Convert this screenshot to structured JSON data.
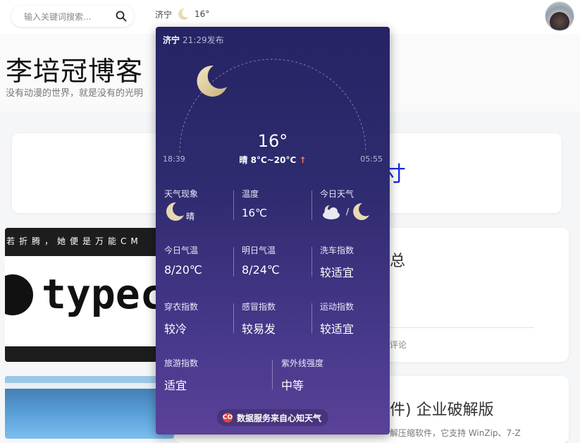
{
  "header": {
    "search_placeholder": "输入关键词搜索...",
    "city": "济宁",
    "temp": "16°"
  },
  "site": {
    "title": "李培冠博客",
    "subtitle": "没有动漫的世界，就是没有的光明"
  },
  "background": {
    "thumb1_band": "若折腾，她便是万能CM",
    "thumb1_word": "typec",
    "post1_title_fragment": "总",
    "post1_meta_fragment": "评论",
    "post2_title_fragment": "件) 企业破解版",
    "post2_excerpt_fragment": "解压缩软件，它支持 WinZip、7-Z",
    "card_title_fragment": "寸"
  },
  "weather_popup": {
    "city": "济宁",
    "published": "21:29发布",
    "current_temp": "16°",
    "condition_range": "晴 8°C~20°C",
    "sunrise": "18:39",
    "sunset": "05:55",
    "rows": [
      [
        {
          "label": "天气现象",
          "value": "晴",
          "icon": "moon-icon"
        },
        {
          "label": "温度",
          "value": "16℃"
        },
        {
          "label": "今日天气",
          "value": "/",
          "icon": "cloud-moon-icon"
        }
      ],
      [
        {
          "label": "今日气温",
          "value": "8/20℃"
        },
        {
          "label": "明日气温",
          "value": "8/24℃"
        },
        {
          "label": "洗车指数",
          "value": "较适宜"
        }
      ],
      [
        {
          "label": "穿衣指数",
          "value": "较冷"
        },
        {
          "label": "感冒指数",
          "value": "较易发"
        },
        {
          "label": "运动指数",
          "value": "较适宜"
        }
      ],
      [
        {
          "label": "旅游指数",
          "value": "适宜"
        },
        {
          "label": "紫外线强度",
          "value": "中等"
        }
      ]
    ],
    "footer": "数据服务来自心知天气",
    "footer_icon_text": "CO"
  },
  "colors": {
    "popup_top": "#252463",
    "popup_bottom": "#5a4298",
    "moon": "#e8d9b0",
    "accent_up": "#ff7a55"
  }
}
